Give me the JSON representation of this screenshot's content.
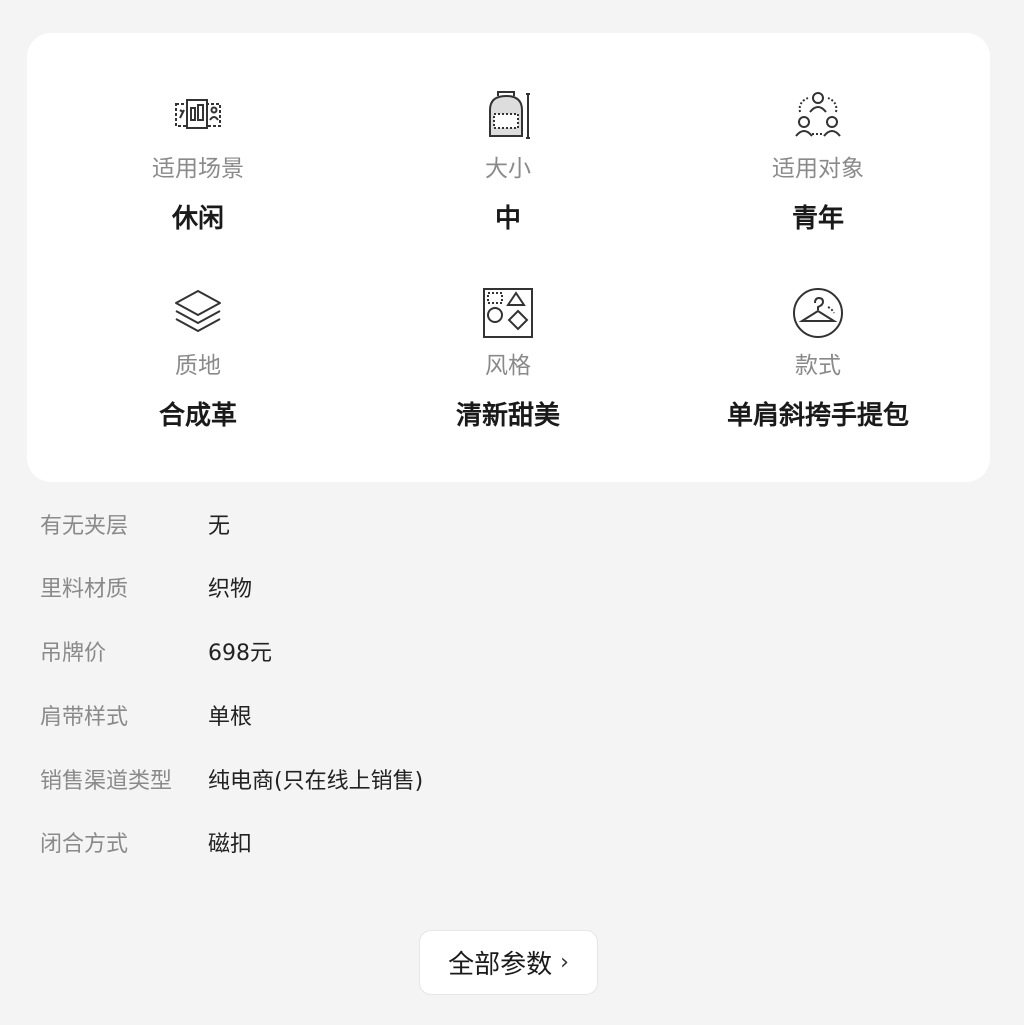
{
  "attributes": [
    {
      "label": "适用场景",
      "value": "休闲",
      "icon": "scene-icon"
    },
    {
      "label": "大小",
      "value": "中",
      "icon": "backpack-size-icon"
    },
    {
      "label": "适用对象",
      "value": "青年",
      "icon": "people-group-icon"
    },
    {
      "label": "质地",
      "value": "合成革",
      "icon": "layers-icon"
    },
    {
      "label": "风格",
      "value": "清新甜美",
      "icon": "shapes-style-icon"
    },
    {
      "label": "款式",
      "value": "单肩斜挎手提包",
      "icon": "hanger-icon"
    }
  ],
  "params": [
    {
      "key": "有无夹层",
      "value": "无"
    },
    {
      "key": "里料材质",
      "value": "织物"
    },
    {
      "key": "吊牌价",
      "value": "698元"
    },
    {
      "key": "肩带样式",
      "value": "单根"
    },
    {
      "key": "销售渠道类型",
      "value": "纯电商(只在线上销售)"
    },
    {
      "key": "闭合方式",
      "value": "磁扣"
    }
  ],
  "all_params_button": {
    "label": "全部参数",
    "chevron": "›"
  },
  "colors": {
    "background": "#f4f4f4",
    "card": "#ffffff",
    "label": "#8a8a8a",
    "value": "#1a1a1a"
  }
}
